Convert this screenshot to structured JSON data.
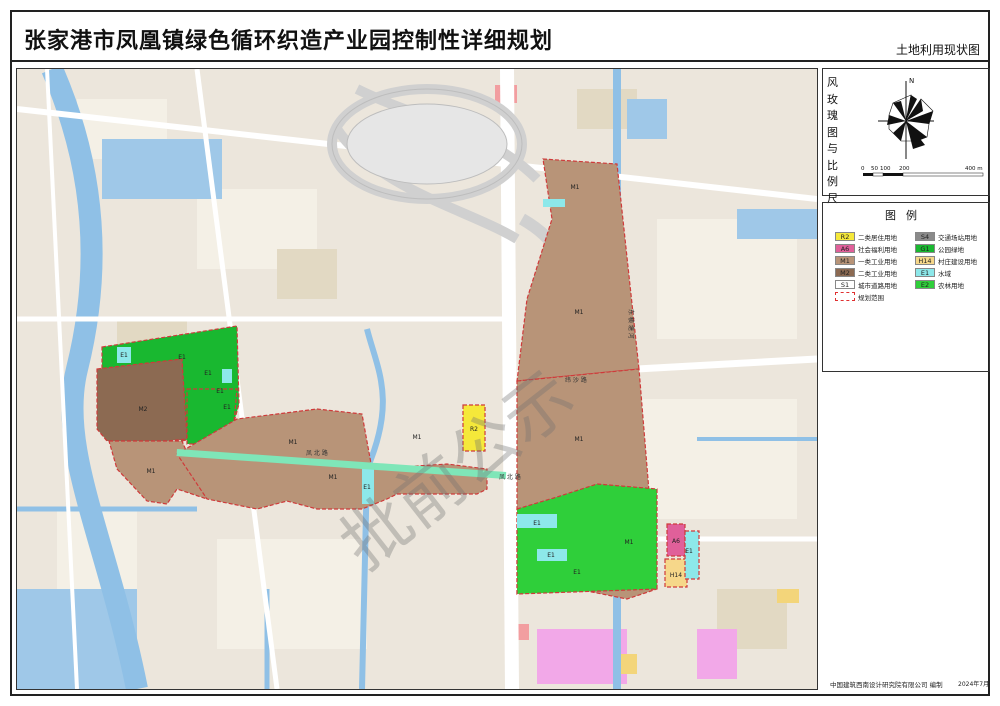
{
  "title": "张家港市凤凰镇绿色循环织造产业园控制性详细规划",
  "subtitle": "土地利用现状图",
  "compass": {
    "label": "风玫瑰图与比例尺",
    "north": "N",
    "scale": [
      "0",
      "50",
      "100",
      "200",
      "400 m"
    ]
  },
  "legend": {
    "title": "图例",
    "items": [
      {
        "code": "R2",
        "label": "二类居住用地",
        "color": "#f5e83a"
      },
      {
        "code": "S4",
        "label": "交通场站用地",
        "color": "#8a8a8a"
      },
      {
        "code": "A6",
        "label": "社会福利用地",
        "color": "#e0609a"
      },
      {
        "code": "G1",
        "label": "公园绿地",
        "color": "#19b830"
      },
      {
        "code": "M1",
        "label": "一类工业用地",
        "color": "#b89478"
      },
      {
        "code": "H14",
        "label": "村庄建设用地",
        "color": "#f6d78a"
      },
      {
        "code": "M2",
        "label": "二类工业用地",
        "color": "#8c6a52"
      },
      {
        "code": "E1",
        "label": "水域",
        "color": "#8de8ea"
      },
      {
        "code": "S1",
        "label": "城市道路用地",
        "color": "#ffffff"
      },
      {
        "code": "E2",
        "label": "农林用地",
        "color": "#2fcf3a"
      },
      {
        "code": "",
        "label": "规划范围",
        "color": "#e03030"
      }
    ]
  },
  "map": {
    "parcels": [
      "M1",
      "M1",
      "M1",
      "M1",
      "M1",
      "M1",
      "M1",
      "M1",
      "M2",
      "E1",
      "E1",
      "E1",
      "E1",
      "R2",
      "A6",
      "H14",
      "E1",
      "E1",
      "E1",
      "E1",
      "E1",
      "E1"
    ],
    "roads": [
      "纬 沙 路",
      "凤 北 路",
      "凤 北 路"
    ],
    "river": "东 横 塘 河",
    "watermark": "批前公示"
  },
  "footer": {
    "credit": "中国建筑西南设计研究院有限公司  编制",
    "date": "2024年7月"
  }
}
